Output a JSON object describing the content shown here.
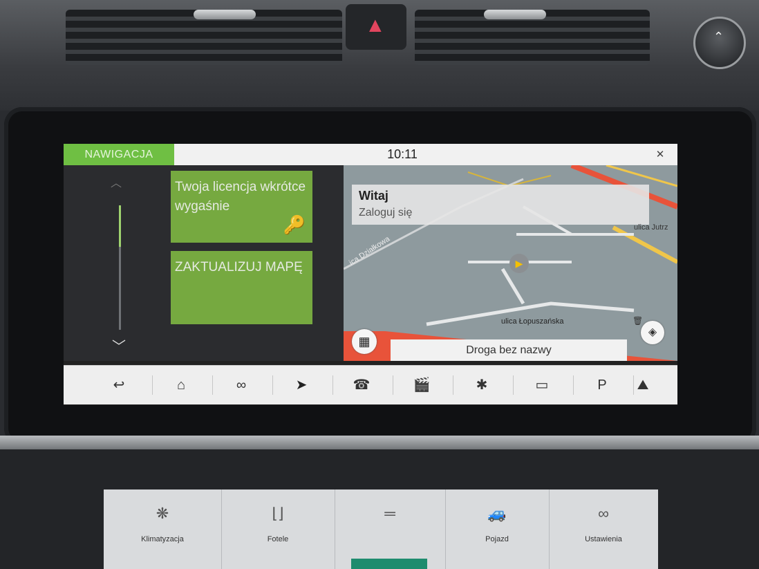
{
  "topbar": {
    "app_title": "NAWIGACJA",
    "clock": "10:11",
    "close_icon": "compass-x-icon"
  },
  "left_panel": {
    "scroll_up_icon": "chevron-up-icon",
    "scroll_down_icon": "chevron-down-icon",
    "tiles": [
      {
        "text": "Twoja licencja wkrótce wygaśnie",
        "icon": "key-icon"
      },
      {
        "text": "ZAKTUALIZUJ MAPĘ"
      }
    ]
  },
  "map": {
    "welcome_title": "Witaj",
    "welcome_subtitle": "Zaloguj się",
    "streets": {
      "dzialkowa": "ica Działkowa",
      "jutrz": "ulica Jutrz",
      "lopus": "ulica Łopuszańska"
    },
    "road_name": "Droga bez nazwy",
    "menu_icon": "grid-icon",
    "layers_icon": "layers-icon",
    "position_icon": "navigation-arrow-icon"
  },
  "bottom_bar": {
    "items": [
      {
        "icon": "back-icon",
        "glyph": "↩"
      },
      {
        "icon": "home-icon",
        "glyph": "⌂"
      },
      {
        "icon": "connected-apps-icon",
        "glyph": "∞"
      },
      {
        "icon": "navigation-icon",
        "glyph": "➤"
      },
      {
        "icon": "phone-icon",
        "glyph": "☎"
      },
      {
        "icon": "media-icon",
        "glyph": "🎬"
      },
      {
        "icon": "bluetooth-icon",
        "glyph": "✱"
      },
      {
        "icon": "camera-icon",
        "glyph": "▭"
      },
      {
        "icon": "parking-icon",
        "glyph": "P"
      },
      {
        "icon": "terrain-icon",
        "glyph": "⛰"
      }
    ]
  },
  "lower_panel": {
    "items": [
      {
        "label": "Klimatyzacja",
        "icon": "climate-icon"
      },
      {
        "label": "Fotele",
        "icon": "seat-icon"
      },
      {
        "label": "",
        "icon": "menu-lines-icon"
      },
      {
        "label": "Pojazd",
        "icon": "vehicle-icon"
      },
      {
        "label": "Ustawienia",
        "icon": "settings-icon"
      }
    ]
  },
  "colors": {
    "accent_green": "#6fbf43",
    "tile_green": "#7cb342",
    "route_red": "#e8533a",
    "arrow_yellow": "#f5c000"
  }
}
